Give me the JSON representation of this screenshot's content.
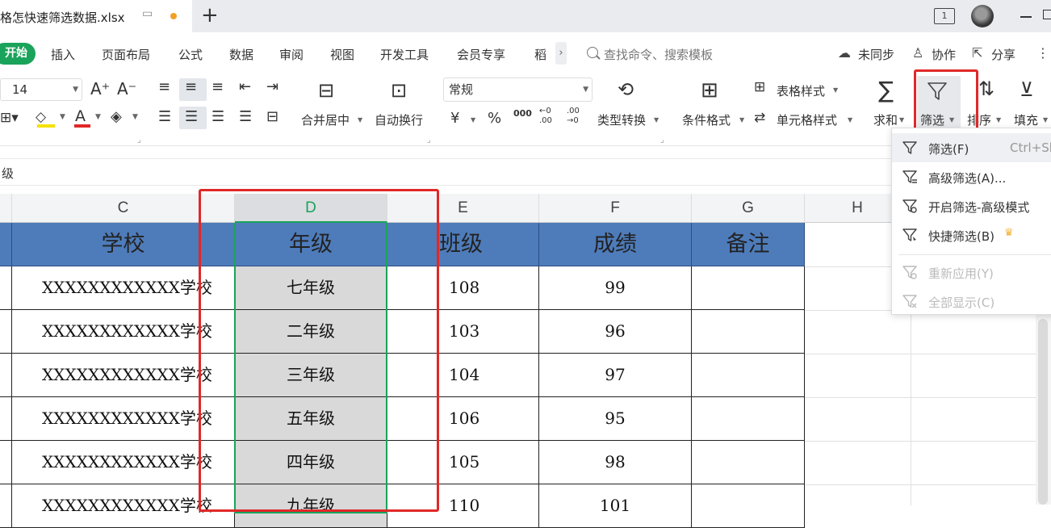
{
  "window": {
    "tab_title": "格怎快速筛选数据.xlsx",
    "add_tab": "+",
    "right_icon_label": "1"
  },
  "menu": {
    "start": "开始",
    "items": [
      "插入",
      "页面布局",
      "公式",
      "数据",
      "审阅",
      "视图",
      "开发工具",
      "会员专享",
      "稻"
    ],
    "more": "›",
    "search_placeholder": "查找命令、搜索模板",
    "sync": "未同步",
    "collab": "协作",
    "share": "分享"
  },
  "ribbon": {
    "font_size": "14",
    "increase_font": "A⁺",
    "decrease_font": "A⁻",
    "merge_center": "合并居中",
    "auto_wrap": "自动换行",
    "number_format": "常规",
    "currency": "¥",
    "percent": "%",
    "thousands": "000",
    "inc_decimal": "←0 .00",
    "dec_decimal": ".00 →0",
    "type_convert": "类型转换",
    "cond_format": "条件格式",
    "table_style": "表格样式",
    "cell_style": "单元格样式",
    "sum": "求和",
    "filter": "筛选",
    "sort": "排序",
    "fill": "填充"
  },
  "formula_bar": {
    "content": "级"
  },
  "grid": {
    "columns": [
      "C",
      "D",
      "E",
      "F",
      "G",
      "H"
    ],
    "selected_column": "D",
    "headers": [
      "学校",
      "年级",
      "班级",
      "成绩",
      "备注"
    ],
    "rows": [
      {
        "school": "XXXXXXXXXXXX学校",
        "grade": "七年级",
        "class": "108",
        "score": "99"
      },
      {
        "school": "XXXXXXXXXXXX学校",
        "grade": "二年级",
        "class": "103",
        "score": "96"
      },
      {
        "school": "XXXXXXXXXXXX学校",
        "grade": "三年级",
        "class": "104",
        "score": "97"
      },
      {
        "school": "XXXXXXXXXXXX学校",
        "grade": "五年级",
        "class": "106",
        "score": "95"
      },
      {
        "school": "XXXXXXXXXXXX学校",
        "grade": "四年级",
        "class": "105",
        "score": "98"
      },
      {
        "school": "XXXXXXXXXXXX学校",
        "grade": "九年级",
        "class": "110",
        "score": "101"
      }
    ]
  },
  "filter_menu": {
    "items": [
      {
        "label": "筛选(F)",
        "shortcut": "Ctrl+Sh",
        "disabled": false
      },
      {
        "label": "高级筛选(A)...",
        "shortcut": "",
        "disabled": false
      },
      {
        "label": "开启筛选-高级模式",
        "shortcut": "",
        "disabled": false
      },
      {
        "label": "快捷筛选(B)",
        "shortcut": "",
        "disabled": false
      },
      {
        "label": "重新应用(Y)",
        "shortcut": "",
        "disabled": true
      },
      {
        "label": "全部显示(C)",
        "shortcut": "",
        "disabled": true
      }
    ]
  },
  "colors": {
    "accent_green": "#1aa35a",
    "header_blue": "#4e7cbb",
    "highlight_red": "#e02828"
  }
}
